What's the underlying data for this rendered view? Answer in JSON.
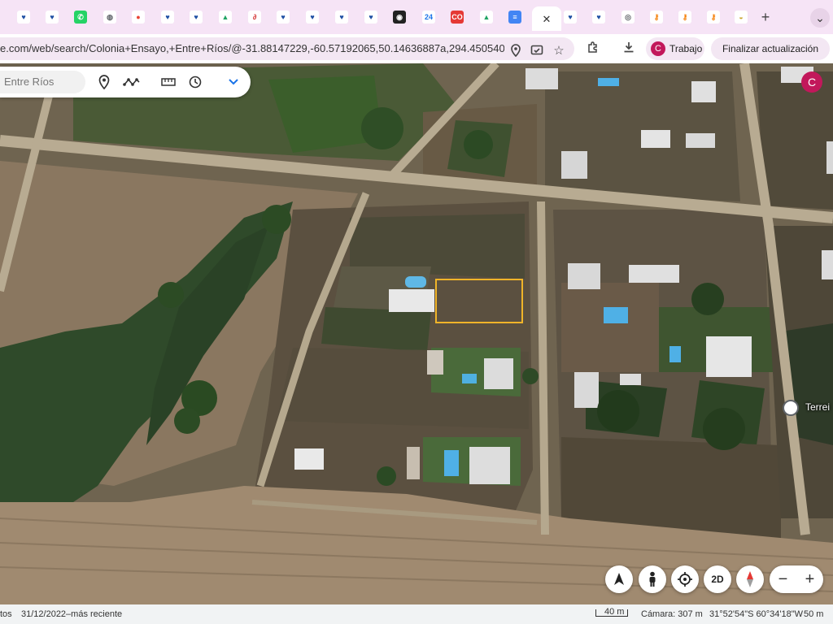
{
  "tabs": [
    {
      "name": "remax",
      "glyph": "♥",
      "color": "#1e4fa3",
      "bg": "#ffffff"
    },
    {
      "name": "remax",
      "glyph": "♥",
      "color": "#1e4fa3",
      "bg": "#ffffff"
    },
    {
      "name": "whatsapp",
      "glyph": "✆",
      "color": "#ffffff",
      "bg": "#25d366"
    },
    {
      "name": "globe",
      "glyph": "◍",
      "color": "#5f6368",
      "bg": "#ffffff"
    },
    {
      "name": "maps",
      "glyph": "●",
      "color": "#ea4335",
      "bg": "#ffffff"
    },
    {
      "name": "remax",
      "glyph": "♥",
      "color": "#1e4fa3",
      "bg": "#ffffff"
    },
    {
      "name": "remax",
      "glyph": "♥",
      "color": "#1e4fa3",
      "bg": "#ffffff"
    },
    {
      "name": "drive",
      "glyph": "▲",
      "color": "#1fa463",
      "bg": "#ffffff"
    },
    {
      "name": "link",
      "glyph": "∂",
      "color": "#d32f2f",
      "bg": "#ffffff"
    },
    {
      "name": "remax",
      "glyph": "♥",
      "color": "#1e4fa3",
      "bg": "#ffffff"
    },
    {
      "name": "remax",
      "glyph": "♥",
      "color": "#1e4fa3",
      "bg": "#ffffff"
    },
    {
      "name": "remax",
      "glyph": "♥",
      "color": "#1e4fa3",
      "bg": "#ffffff"
    },
    {
      "name": "remax",
      "glyph": "♥",
      "color": "#1e4fa3",
      "bg": "#ffffff"
    },
    {
      "name": "record",
      "glyph": "◉",
      "color": "#ffffff",
      "bg": "#222222"
    },
    {
      "name": "calendar",
      "glyph": "24",
      "color": "#1a73e8",
      "bg": "#ffffff"
    },
    {
      "name": "co",
      "glyph": "CO",
      "color": "#ffffff",
      "bg": "#e53935"
    },
    {
      "name": "drive",
      "glyph": "▲",
      "color": "#1fa463",
      "bg": "#ffffff"
    },
    {
      "name": "docs",
      "glyph": "≡",
      "color": "#ffffff",
      "bg": "#4285f4"
    },
    {
      "name": "active-close",
      "glyph": "✕",
      "color": "#333333",
      "bg": "transparent"
    },
    {
      "name": "remax",
      "glyph": "♥",
      "color": "#1e4fa3",
      "bg": "#ffffff"
    },
    {
      "name": "remax",
      "glyph": "♥",
      "color": "#1e4fa3",
      "bg": "#ffffff"
    },
    {
      "name": "chrome",
      "glyph": "◎",
      "color": "#5f6368",
      "bg": "#ffffff"
    },
    {
      "name": "key",
      "glyph": "⚷",
      "color": "#f57c00",
      "bg": "#ffffff"
    },
    {
      "name": "key",
      "glyph": "⚷",
      "color": "#f57c00",
      "bg": "#ffffff"
    },
    {
      "name": "key",
      "glyph": "⚷",
      "color": "#f57c00",
      "bg": "#ffffff"
    },
    {
      "name": "earth",
      "glyph": "◒",
      "color": "#c9a227",
      "bg": "#ffffff"
    }
  ],
  "new_tab_label": "+",
  "tab_menu_label": "⌄",
  "url": "e.com/web/search/Colonia+Ensayo,+Entre+Ríos/@-31.88147229,-60.57192065,50.14636887a,294.45054003...",
  "profile_pill": {
    "initial": "C",
    "label": "Trabajo"
  },
  "update_pill": {
    "label": "Finalizar actualización"
  },
  "search": {
    "value": "Entre Ríos"
  },
  "avatar_initial": "C",
  "map_controls": {
    "toggle_2d": "2D",
    "zoom_out": "−",
    "zoom_in": "+"
  },
  "poi_label": "Terrei",
  "status": {
    "left": "tos",
    "date": "31/12/2022–más reciente",
    "scale": "40 m",
    "camera": "Cámara: 307 m",
    "coords": "31°52'54\"S 60°34'18\"W",
    "elevation": "50 m"
  },
  "colors": {
    "tabbar": "#f6e4f6",
    "accent": "#c2185b",
    "selection": "#f0b429"
  }
}
